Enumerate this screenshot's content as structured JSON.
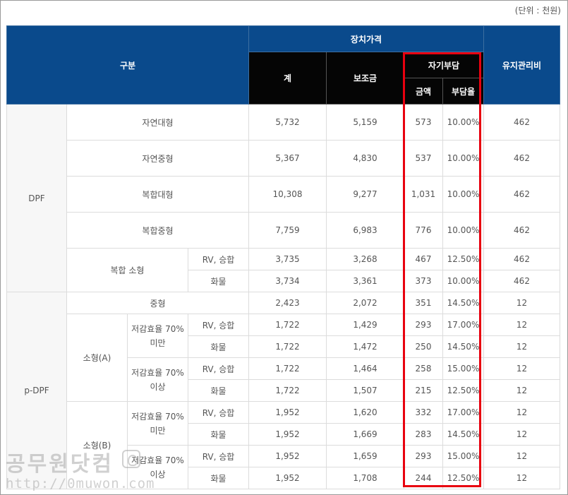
{
  "unit_note": "(단위 : 천원)",
  "headers": {
    "category": "구분",
    "device_price": "장치가격",
    "total": "계",
    "subsidy": "보조금",
    "self_pay": "자기부담",
    "amount": "금액",
    "ratio": "부담율",
    "maintenance": "유지관리비"
  },
  "groups": {
    "dpf": "DPF",
    "pdpf": "p-DPF",
    "compound_small": "복합 소형",
    "small_a": "소형(A)",
    "small_b": "소형(B)",
    "eff_under_70": "저감효율 70% 미만",
    "eff_over_70": "저감효율 70% 이상"
  },
  "rows": [
    {
      "label": "자연대형",
      "total": "5,732",
      "subsidy": "5,159",
      "amount": "573",
      "ratio": "10.00%",
      "maint": "462"
    },
    {
      "label": "자연중형",
      "total": "5,367",
      "subsidy": "4,830",
      "amount": "537",
      "ratio": "10.00%",
      "maint": "462"
    },
    {
      "label": "복합대형",
      "total": "10,308",
      "subsidy": "9,277",
      "amount": "1,031",
      "ratio": "10.00%",
      "maint": "462"
    },
    {
      "label": "복합중형",
      "total": "7,759",
      "subsidy": "6,983",
      "amount": "776",
      "ratio": "10.00%",
      "maint": "462"
    },
    {
      "label": "RV, 승합",
      "total": "3,735",
      "subsidy": "3,268",
      "amount": "467",
      "ratio": "12.50%",
      "maint": "462"
    },
    {
      "label": "화물",
      "total": "3,734",
      "subsidy": "3,361",
      "amount": "373",
      "ratio": "10.00%",
      "maint": "462"
    },
    {
      "label": "중형",
      "total": "2,423",
      "subsidy": "2,072",
      "amount": "351",
      "ratio": "14.50%",
      "maint": "12"
    },
    {
      "label": "RV, 승합",
      "total": "1,722",
      "subsidy": "1,429",
      "amount": "293",
      "ratio": "17.00%",
      "maint": "12"
    },
    {
      "label": "화물",
      "total": "1,722",
      "subsidy": "1,472",
      "amount": "250",
      "ratio": "14.50%",
      "maint": "12"
    },
    {
      "label": "RV, 승합",
      "total": "1,722",
      "subsidy": "1,464",
      "amount": "258",
      "ratio": "15.00%",
      "maint": "12"
    },
    {
      "label": "화물",
      "total": "1,722",
      "subsidy": "1,507",
      "amount": "215",
      "ratio": "12.50%",
      "maint": "12"
    },
    {
      "label": "RV, 승합",
      "total": "1,952",
      "subsidy": "1,620",
      "amount": "332",
      "ratio": "17.00%",
      "maint": "12"
    },
    {
      "label": "화물",
      "total": "1,952",
      "subsidy": "1,669",
      "amount": "283",
      "ratio": "14.50%",
      "maint": "12"
    },
    {
      "label": "RV, 승합",
      "total": "1,952",
      "subsidy": "1,659",
      "amount": "293",
      "ratio": "15.00%",
      "maint": "12"
    },
    {
      "label": "화물",
      "total": "1,952",
      "subsidy": "1,708",
      "amount": "244",
      "ratio": "12.50%",
      "maint": "12"
    }
  ],
  "watermark": {
    "name": "공무원닷컴",
    "url": "http://0muwon.com",
    "icon": "owl-logo-icon"
  },
  "colors": {
    "header_blue": "#0a4a8c",
    "header_black": "#050505",
    "highlight_red": "#e8000f"
  }
}
